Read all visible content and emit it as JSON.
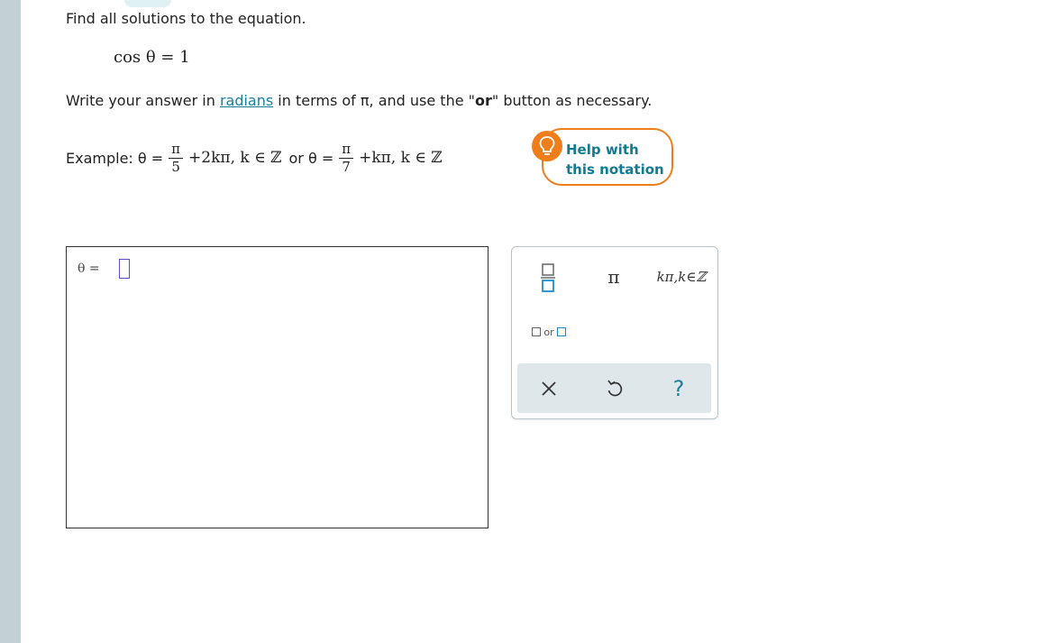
{
  "question": {
    "prompt": "Find all solutions to the equation.",
    "equation": "cos θ = 1",
    "instruction_before": "Write your answer in ",
    "instruction_link": "radians",
    "instruction_mid": " in terms of π, and use the \"",
    "instruction_bold": "or",
    "instruction_after": "\" button as necessary."
  },
  "example": {
    "label": "Example: θ =",
    "frac1_num": "π",
    "frac1_den": "5",
    "term1": "+2kπ, k ∈ ℤ",
    "or_text": "or θ =",
    "frac2_num": "π",
    "frac2_den": "7",
    "term2": "+kπ, k ∈ ℤ"
  },
  "help": {
    "line1": "Help with",
    "line2": "this notation",
    "icon": "lightbulb-icon",
    "color": "#ef7d1a"
  },
  "answer": {
    "label": "θ ="
  },
  "keypad": {
    "pi_label": "π",
    "kpi_label": "kπ,k∈ℤ",
    "or_label": "or",
    "help_label": "?"
  },
  "colors": {
    "accent": "#1a7f9c",
    "cursor": "#5b4ccc",
    "sidebar": "#c3d0d5"
  }
}
